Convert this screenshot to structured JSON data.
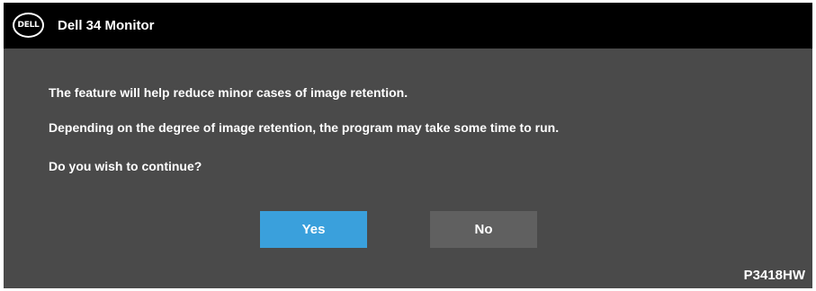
{
  "title_bar": {
    "logo_icon": "dell-logo-icon",
    "logo_text": "DELL",
    "title": "Dell 34 Monitor"
  },
  "dialog": {
    "lines": [
      "The feature will help reduce minor cases of image retention.",
      "Depending on the degree of image retention, the program may take some time to run.",
      "Do you wish to continue?"
    ],
    "yes_label": "Yes",
    "no_label": "No"
  },
  "footer": {
    "model": "P3418HW"
  },
  "colors": {
    "title_bar_bg": "#000000",
    "dialog_bg": "#4a4a4a",
    "yes_button": "#3aa0dc",
    "no_button": "#606060",
    "text": "#ffffff"
  }
}
